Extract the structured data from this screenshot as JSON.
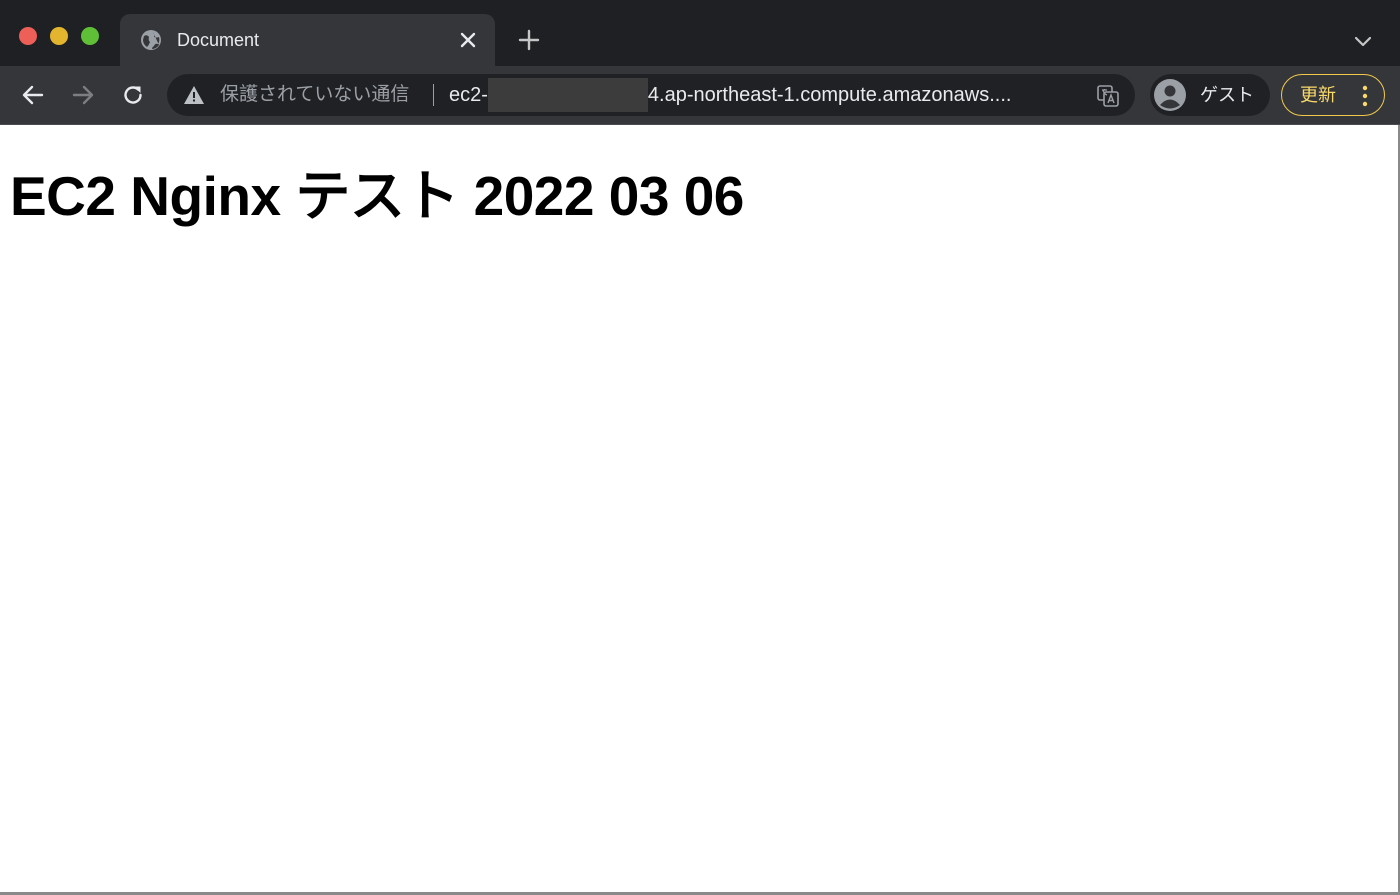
{
  "window": {
    "traffic_lights": [
      "close",
      "minimize",
      "maximize"
    ]
  },
  "tab": {
    "title": "Document",
    "favicon": "globe-icon",
    "close_icon": "close-icon"
  },
  "new_tab": {
    "icon": "plus-icon"
  },
  "tab_search": {
    "icon": "chevron-down-icon"
  },
  "toolbar": {
    "back_icon": "arrow-left-icon",
    "forward_icon": "arrow-right-icon",
    "reload_icon": "reload-icon"
  },
  "omnibox": {
    "warning_icon": "warning-triangle-icon",
    "security_text": "保護されていない通信",
    "url_prefix": "ec2-",
    "url_suffix": "4.ap-northeast-1.compute.amazonaws....",
    "translate_icon": "translate-icon"
  },
  "profile": {
    "avatar_icon": "person-avatar-icon",
    "label": "ゲスト"
  },
  "update_button": {
    "label": "更新",
    "menu_icon": "kebab-menu-icon"
  },
  "page": {
    "heading": "EC2 Nginx テスト 2022 03 06"
  },
  "colors": {
    "tabstrip_bg": "#1f2023",
    "toolbar_bg": "#35363a",
    "omnibox_bg": "#202124",
    "update_accent": "#f2c94c",
    "page_bg": "#ffffff"
  }
}
